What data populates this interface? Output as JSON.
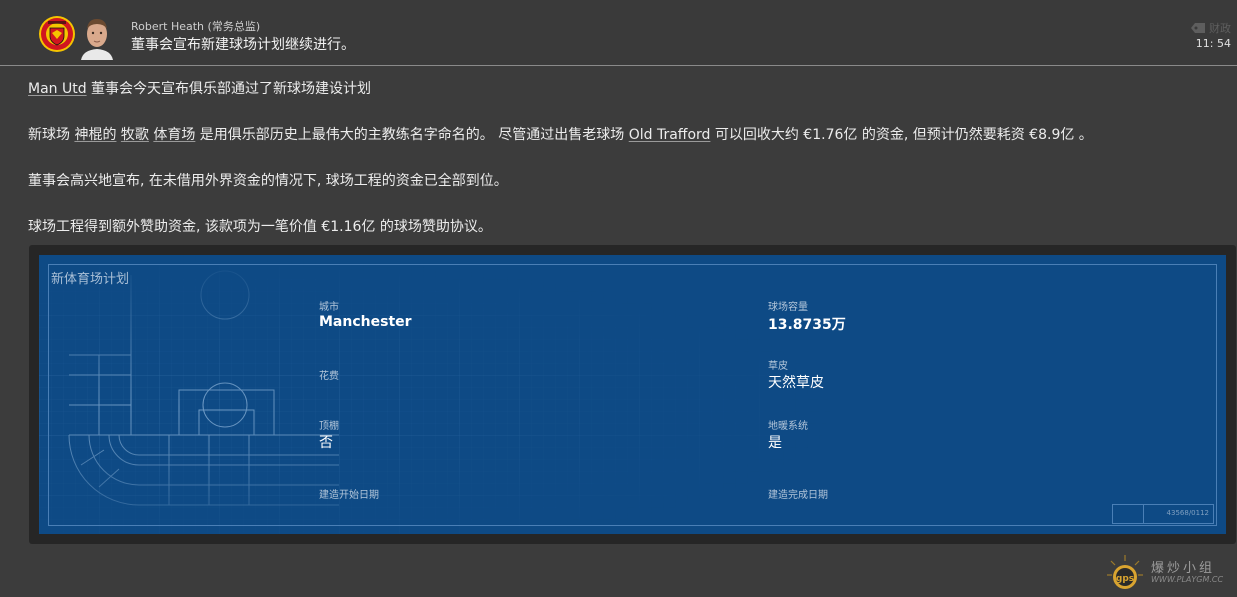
{
  "header": {
    "sender_name": "Robert Heath",
    "sender_role": "(常务总监)",
    "headline": "董事会宣布新建球场计划继续进行。",
    "category_tag": "财政",
    "time": "11: 54",
    "club_crest_icon": "manchester-united-crest",
    "avatar_icon": "staff-face-portrait"
  },
  "body": {
    "p1": {
      "club_link": "Man Utd",
      "text": " 董事会今天宣布俱乐部通过了新球场建设计划"
    },
    "p2": {
      "t1": "新球场 ",
      "stadium_part1": "神棍的",
      "t2": " ",
      "stadium_part2": "牧歌",
      "t3": " ",
      "stadium_part3": "体育场",
      "t4": " 是用俱乐部历史上最伟大的主教练名字命名的。 尽管通过出售老球场 ",
      "old_stadium_link": "Old Trafford",
      "t5": " 可以回收大约 €1.76亿 的资金, 但预计仍然要耗资 €8.9亿 。"
    },
    "p3": "董事会高兴地宣布, 在未借用外界资金的情况下, 球场工程的资金已全部到位。",
    "p4": "球场工程得到额外赞助资金, 该款项为一笔价值 €1.16亿 的球场赞助协议。"
  },
  "card": {
    "title": "新体育场计划",
    "city_label": "城市",
    "city_value": "Manchester",
    "capacity_label": "球场容量",
    "capacity_value": "13.8735万",
    "cost_label": "花费",
    "pitch_label": "草皮",
    "pitch_value": "天然草皮",
    "roof_label": "顶棚",
    "roof_value": "否",
    "heating_label": "地暖系统",
    "heating_value": "是",
    "start_label": "建造开始日期",
    "end_label": "建造完成日期",
    "stamp_code": "43568/0112"
  },
  "watermark": {
    "text": "爆炒小组",
    "url": "WWW.PLAYGM.CC",
    "logo_icon": "gps-badge"
  },
  "colors": {
    "background": "#3c3c3c",
    "blueprint": "#0e4a85",
    "crest_red": "#d0161f",
    "crest_yellow": "#f5c400"
  }
}
